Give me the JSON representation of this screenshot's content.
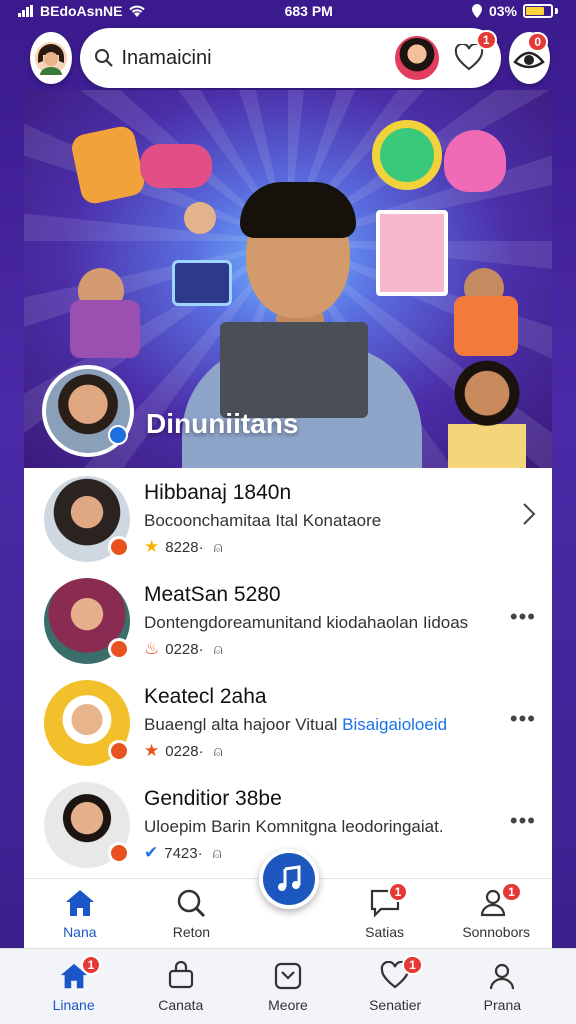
{
  "status_bar": {
    "carrier": "BEdoAsnNE",
    "time": "683 PM",
    "battery": "03%"
  },
  "header": {
    "search_placeholder": "Inamaicini",
    "notifications_badge": "1",
    "profile_badge": "0"
  },
  "hero": {
    "title": "Dinuniitans"
  },
  "list": {
    "items": [
      {
        "title": "Hibbanaj 1840n",
        "subtitle": "Bocoonchamitaa Ital Konataore",
        "subtitle_link": "",
        "meta": "8228·",
        "meta_icon": "star-icon",
        "action": "chevron-right",
        "avatar_color": "#2b2320"
      },
      {
        "title": "MeatSan 5280",
        "subtitle": "Dontengdoreamunitand kiodahaolan Iidoas",
        "subtitle_link": "",
        "meta": "0228·",
        "meta_icon": "flame-icon",
        "action": "more",
        "avatar_color": "#8a2b52"
      },
      {
        "title": "Keatecl 2aha",
        "subtitle": "Buaengl alta hajoor Vitual ",
        "subtitle_link": "Bisaigaioloeid",
        "meta": "0228·",
        "meta_icon": "star-icon",
        "action": "more",
        "avatar_color": "#f2c02a"
      },
      {
        "title": "Genditior 38be",
        "subtitle": "Uloepim Barin Komnitgna leodoringaiat.",
        "subtitle_link": "",
        "meta": "7423·",
        "meta_icon": "check-icon",
        "action": "more",
        "avatar_color": "#e8e8e8"
      }
    ]
  },
  "tabbar_primary": {
    "tabs": [
      {
        "label": "Nana",
        "icon": "home-icon",
        "active": true
      },
      {
        "label": "Reton",
        "icon": "search-icon",
        "active": false
      },
      {
        "label": "Satias",
        "icon": "chat-icon",
        "active": false,
        "badge": "1"
      },
      {
        "label": "Sonnobors",
        "icon": "people-icon",
        "active": false,
        "badge": "1"
      }
    ],
    "fab_icon": "music-note-icon"
  },
  "tabbar_secondary": {
    "tabs": [
      {
        "label": "Linane",
        "icon": "home-icon",
        "active": true,
        "badge": "1"
      },
      {
        "label": "Canata",
        "icon": "bag-icon",
        "active": false
      },
      {
        "label": "Meore",
        "icon": "box-icon",
        "active": false
      },
      {
        "label": "Senatier",
        "icon": "heart-icon",
        "active": false,
        "badge": "1"
      },
      {
        "label": "Prana",
        "icon": "person-icon",
        "active": false
      }
    ]
  },
  "colors": {
    "accent": "#1c57c0",
    "badge": "#e53935",
    "background": "#3a1a8c"
  }
}
